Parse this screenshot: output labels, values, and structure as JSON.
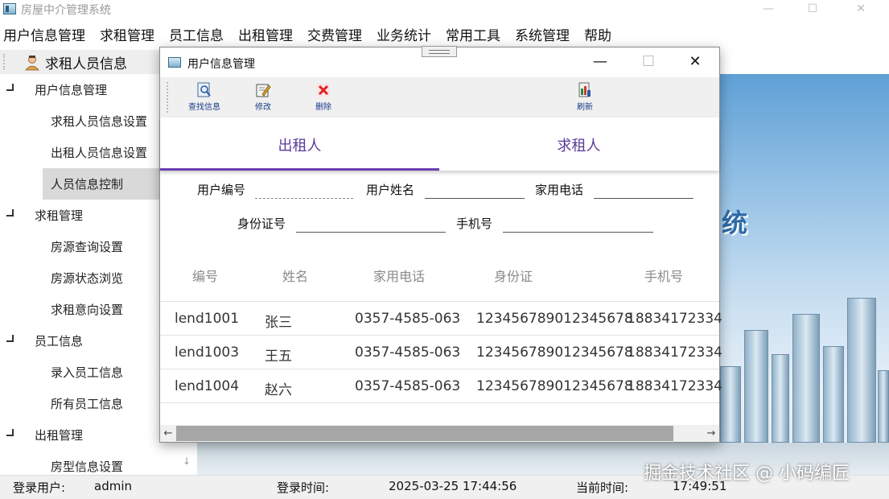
{
  "app": {
    "title": "房屋中介管理系统",
    "minimize": "—",
    "maximize": "☐",
    "close": "✕"
  },
  "menu": [
    "用户信息管理",
    "求租管理",
    "员工信息",
    "出租管理",
    "交费管理",
    "业务统计",
    "常用工具",
    "系统管理",
    "帮助"
  ],
  "nav": {
    "header": "求租人员信息",
    "groups": [
      {
        "label": "用户信息管理",
        "items": [
          "求租人员信息设置",
          "出租人员信息设置",
          "人员信息控制"
        ]
      },
      {
        "label": "求租管理",
        "items": [
          "房源查询设置",
          "房源状态浏览",
          "求租意向设置"
        ]
      },
      {
        "label": "员工信息",
        "items": [
          "录入员工信息",
          "所有员工信息"
        ]
      },
      {
        "label": "出租管理",
        "items": [
          "房型信息设置"
        ]
      }
    ],
    "active_item": "人员信息控制"
  },
  "banner": {
    "text": "统"
  },
  "dialog": {
    "title": "用户信息管理",
    "minimize": "—",
    "maximize": "☐",
    "close": "✕",
    "toolbar": [
      {
        "label": "查找信息",
        "icon": "search-doc-icon"
      },
      {
        "label": "修改",
        "icon": "edit-icon"
      },
      {
        "label": "删除",
        "icon": "delete-icon"
      },
      {
        "label": "刷新",
        "icon": "refresh-icon"
      }
    ],
    "tabs": [
      "出租人",
      "求租人"
    ],
    "active_tab": "出租人",
    "form": {
      "user_id_label": "用户编号",
      "user_id_value": "",
      "user_name_label": "用户姓名",
      "user_name_value": "",
      "home_phone_label": "家用电话",
      "home_phone_value": "",
      "id_card_label": "身份证号",
      "id_card_value": "",
      "mobile_label": "手机号",
      "mobile_value": ""
    },
    "table": {
      "columns": [
        "编号",
        "姓名",
        "家用电话",
        "身份证",
        "手机号"
      ],
      "rows": [
        [
          "lend1001",
          "张三",
          "0357-4585-063",
          "123456789012345678",
          "18834172334"
        ],
        [
          "lend1003",
          "王五",
          "0357-4585-063",
          "123456789012345678",
          "18834172334"
        ],
        [
          "lend1004",
          "赵六",
          "0357-4585-063",
          "123456789012345678",
          "18834172334"
        ]
      ]
    },
    "scroll_left": "←",
    "scroll_right": "→"
  },
  "status": {
    "user_label": "登录用户:",
    "user_value": "admin",
    "login_time_label": "登录时间:",
    "login_time_value": "2025-03-25 17:44:56",
    "current_time_label": "当前时间:",
    "current_time_value": "17:49:51"
  },
  "watermark": "掘金技术社区 @ 小码编匠",
  "colors": {
    "accent": "#6a3fb0",
    "active_nav": "#d9d9d9",
    "toolbar_bg": "#f0f0f0"
  }
}
